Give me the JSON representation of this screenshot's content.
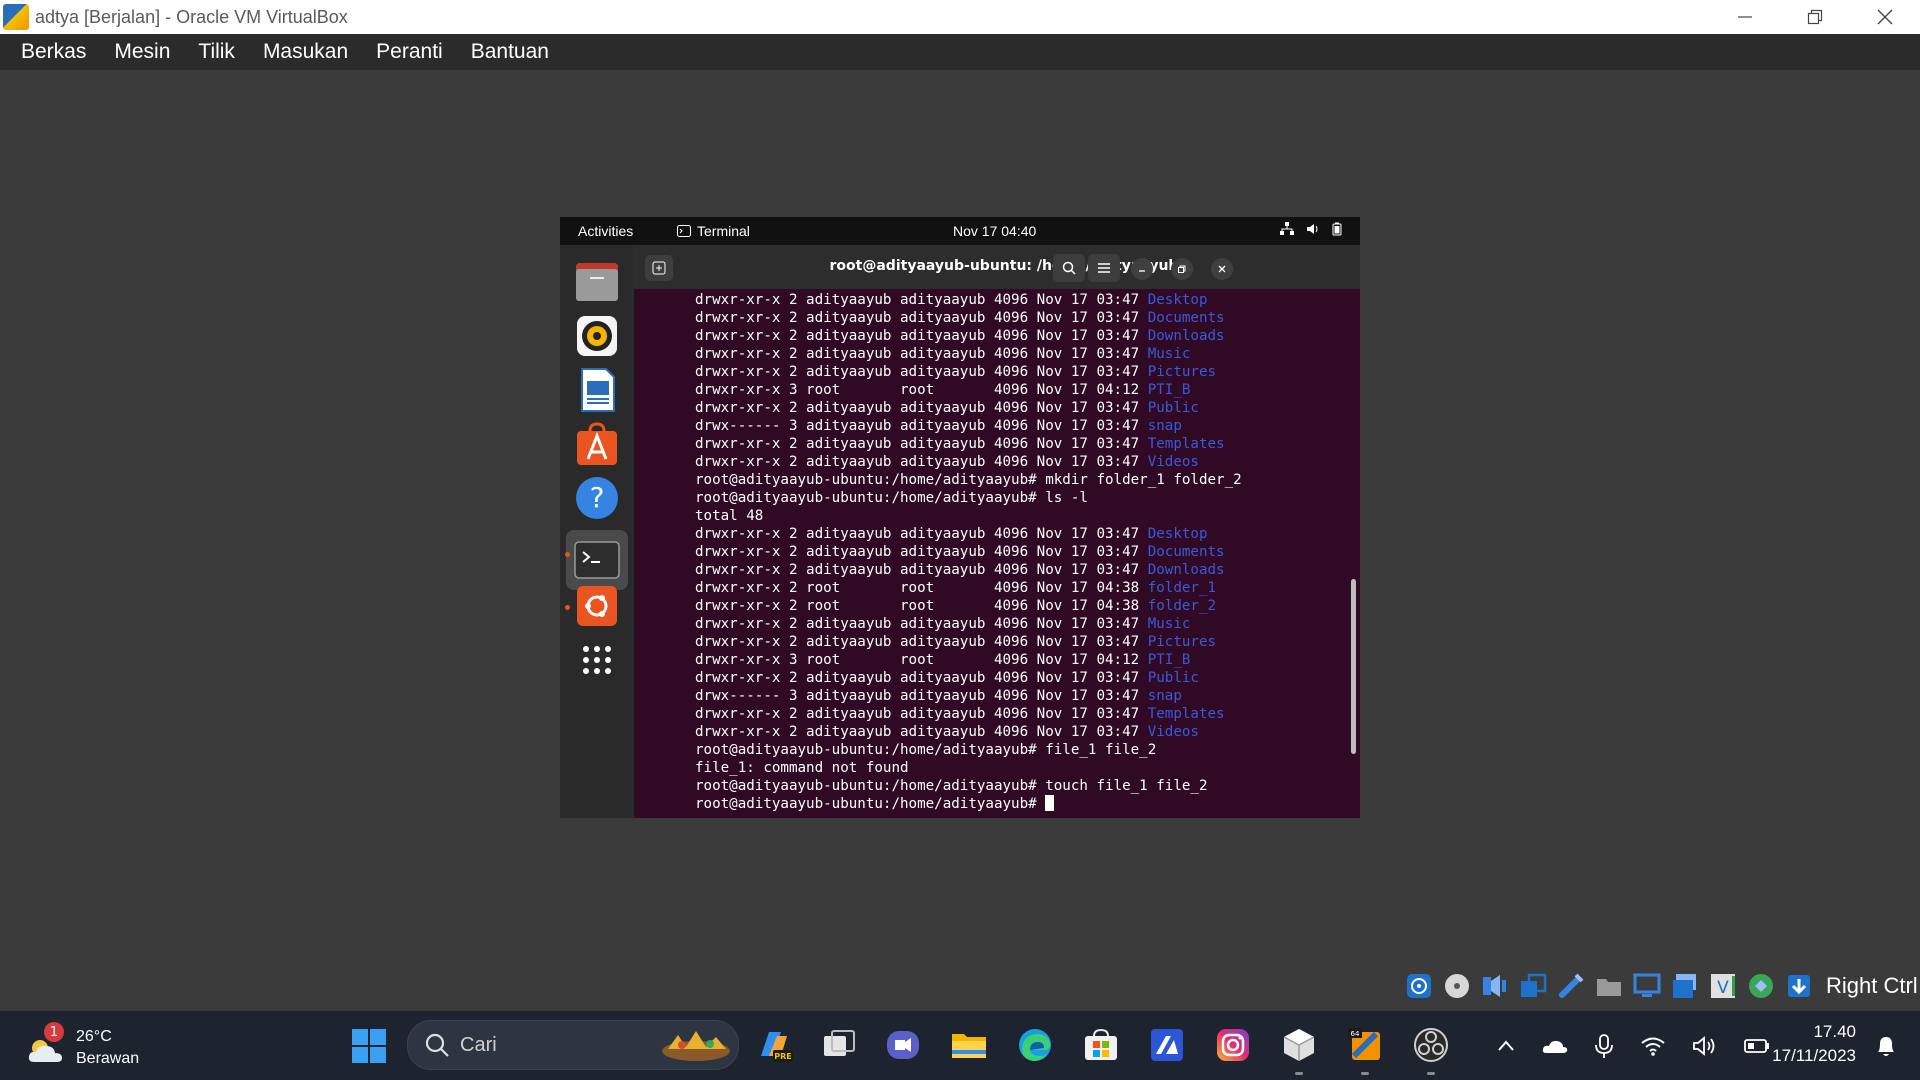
{
  "window": {
    "title": "adtya [Berjalan] - Oracle VM VirtualBox"
  },
  "menu": [
    "Berkas",
    "Mesin",
    "Tilik",
    "Masukan",
    "Peranti",
    "Bantuan"
  ],
  "gnome": {
    "activities": "Activities",
    "app_name": "Terminal",
    "clock": "Nov 17  04:40"
  },
  "terminal": {
    "title": "root@adityaayub-ubuntu: /home/adityaayub",
    "lines": [
      {
        "text": "drwxr-xr-x 2 adityaayub adityaayub 4096 Nov 17 03:47 ",
        "dir": "Desktop"
      },
      {
        "text": "drwxr-xr-x 2 adityaayub adityaayub 4096 Nov 17 03:47 ",
        "dir": "Documents"
      },
      {
        "text": "drwxr-xr-x 2 adityaayub adityaayub 4096 Nov 17 03:47 ",
        "dir": "Downloads"
      },
      {
        "text": "drwxr-xr-x 2 adityaayub adityaayub 4096 Nov 17 03:47 ",
        "dir": "Music"
      },
      {
        "text": "drwxr-xr-x 2 adityaayub adityaayub 4096 Nov 17 03:47 ",
        "dir": "Pictures"
      },
      {
        "text": "drwxr-xr-x 3 root       root       4096 Nov 17 04:12 ",
        "dir": "PTI_B"
      },
      {
        "text": "drwxr-xr-x 2 adityaayub adityaayub 4096 Nov 17 03:47 ",
        "dir": "Public"
      },
      {
        "text": "drwx------ 3 adityaayub adityaayub 4096 Nov 17 03:47 ",
        "dir": "snap"
      },
      {
        "text": "drwxr-xr-x 2 adityaayub adityaayub 4096 Nov 17 03:47 ",
        "dir": "Templates"
      },
      {
        "text": "drwxr-xr-x 2 adityaayub adityaayub 4096 Nov 17 03:47 ",
        "dir": "Videos"
      },
      {
        "text": "root@adityaayub-ubuntu:/home/adityaayub# mkdir folder_1 folder_2",
        "dir": ""
      },
      {
        "text": "root@adityaayub-ubuntu:/home/adityaayub# ls -l",
        "dir": ""
      },
      {
        "text": "total 48",
        "dir": ""
      },
      {
        "text": "drwxr-xr-x 2 adityaayub adityaayub 4096 Nov 17 03:47 ",
        "dir": "Desktop"
      },
      {
        "text": "drwxr-xr-x 2 adityaayub adityaayub 4096 Nov 17 03:47 ",
        "dir": "Documents"
      },
      {
        "text": "drwxr-xr-x 2 adityaayub adityaayub 4096 Nov 17 03:47 ",
        "dir": "Downloads"
      },
      {
        "text": "drwxr-xr-x 2 root       root       4096 Nov 17 04:38 ",
        "dir": "folder_1"
      },
      {
        "text": "drwxr-xr-x 2 root       root       4096 Nov 17 04:38 ",
        "dir": "folder_2"
      },
      {
        "text": "drwxr-xr-x 2 adityaayub adityaayub 4096 Nov 17 03:47 ",
        "dir": "Music"
      },
      {
        "text": "drwxr-xr-x 2 adityaayub adityaayub 4096 Nov 17 03:47 ",
        "dir": "Pictures"
      },
      {
        "text": "drwxr-xr-x 3 root       root       4096 Nov 17 04:12 ",
        "dir": "PTI_B"
      },
      {
        "text": "drwxr-xr-x 2 adityaayub adityaayub 4096 Nov 17 03:47 ",
        "dir": "Public"
      },
      {
        "text": "drwx------ 3 adityaayub adityaayub 4096 Nov 17 03:47 ",
        "dir": "snap"
      },
      {
        "text": "drwxr-xr-x 2 adityaayub adityaayub 4096 Nov 17 03:47 ",
        "dir": "Templates"
      },
      {
        "text": "drwxr-xr-x 2 adityaayub adityaayub 4096 Nov 17 03:47 ",
        "dir": "Videos"
      },
      {
        "text": "root@adityaayub-ubuntu:/home/adityaayub# file_1 file_2",
        "dir": ""
      },
      {
        "text": "file_1: command not found",
        "dir": ""
      },
      {
        "text": "root@adityaayub-ubuntu:/home/adityaayub# touch file_1 file_2",
        "dir": ""
      },
      {
        "text": "root@adityaayub-ubuntu:/home/adityaayub# ",
        "dir": "",
        "cursor": true
      }
    ]
  },
  "dock": [
    "files-icon",
    "rhythmbox-icon",
    "writer-icon",
    "software-center-icon",
    "help-icon",
    "terminal-icon",
    "ubuntu-icon",
    "app-grid-icon"
  ],
  "vbox_status": {
    "host_key": "Right Ctrl"
  },
  "taskbar": {
    "weather_temp": "26°C",
    "weather_desc": "Berawan",
    "weather_badge": "1",
    "search_placeholder": "Cari",
    "time": "17.40",
    "date": "17/11/2023"
  },
  "colors": {
    "terminal_bg": "#300a24",
    "dir_color": "#3a5ad8",
    "accent": "#e95420"
  }
}
